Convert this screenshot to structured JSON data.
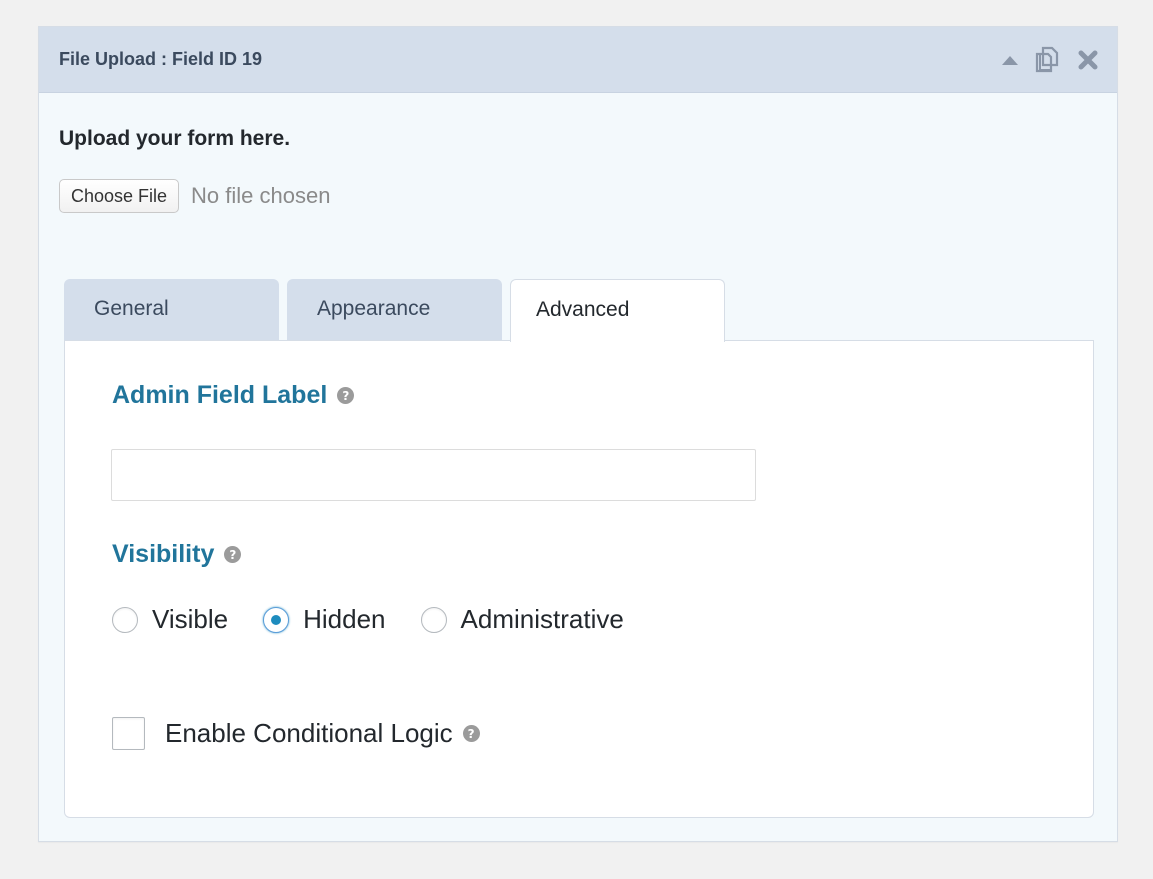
{
  "panel": {
    "title": "File Upload : Field ID 19",
    "icons": [
      "collapse-arrow-icon",
      "duplicate-icon",
      "close-icon"
    ]
  },
  "field": {
    "label": "Upload your form here.",
    "choose_button": "Choose File",
    "file_status": "No file chosen"
  },
  "tabs": [
    {
      "label": "General",
      "active": false
    },
    {
      "label": "Appearance",
      "active": false
    },
    {
      "label": "Advanced",
      "active": true
    }
  ],
  "advanced": {
    "admin_label": {
      "title": "Admin Field Label",
      "value": "",
      "help_icon": "question-icon"
    },
    "visibility": {
      "title": "Visibility",
      "options": [
        {
          "label": "Visible",
          "checked": false
        },
        {
          "label": "Hidden",
          "checked": true
        },
        {
          "label": "Administrative",
          "checked": false
        }
      ]
    },
    "conditional_logic": {
      "label": "Enable Conditional Logic",
      "checked": false
    }
  },
  "colors": {
    "header_bg": "#d4deeb",
    "section_title": "#21759b",
    "radio_accent": "#1e8cbe"
  }
}
